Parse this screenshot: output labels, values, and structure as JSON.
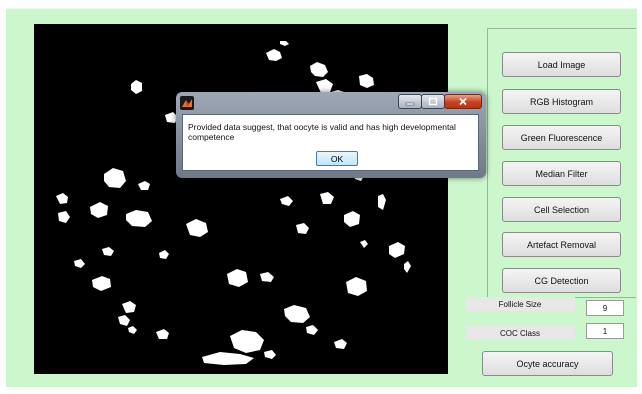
{
  "buttons": {
    "load_image": "Load Image",
    "rgb_histogram": "RGB Histogram",
    "green_fluorescence": "Green Fluorescence",
    "median_filter": "Median Filter",
    "cell_selection": "Cell Selection",
    "artefact_removal": "Artefact Removal",
    "cg_detection": "CG Detection",
    "oocyte_accuracy": "Ocyte accuracy"
  },
  "fields": {
    "follicle_size_label": "Follicle Size",
    "follicle_size_value": "9",
    "coc_class_label": "COC Class",
    "coc_class_value": "1"
  },
  "dialog": {
    "message": "Provided data suggest, that oocyte is valid and has high developmental competence",
    "ok_label": "OK",
    "app_icon": "matlab-icon"
  },
  "colors": {
    "background": "#ccf7cc",
    "image_background": "#000000",
    "blob": "#ffffff",
    "close_button": "#c6411e"
  }
}
